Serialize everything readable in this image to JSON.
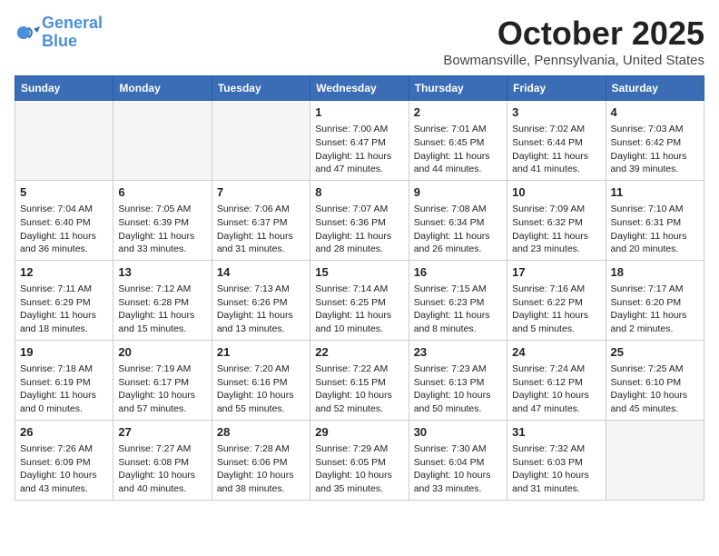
{
  "header": {
    "logo_line1": "General",
    "logo_line2": "Blue",
    "month": "October 2025",
    "location": "Bowmansville, Pennsylvania, United States"
  },
  "days_of_week": [
    "Sunday",
    "Monday",
    "Tuesday",
    "Wednesday",
    "Thursday",
    "Friday",
    "Saturday"
  ],
  "weeks": [
    {
      "days": [
        {
          "number": "",
          "empty": true
        },
        {
          "number": "",
          "empty": true
        },
        {
          "number": "",
          "empty": true
        },
        {
          "number": "1",
          "sunrise": "7:00 AM",
          "sunset": "6:47 PM",
          "daylight": "11 hours and 47 minutes."
        },
        {
          "number": "2",
          "sunrise": "7:01 AM",
          "sunset": "6:45 PM",
          "daylight": "11 hours and 44 minutes."
        },
        {
          "number": "3",
          "sunrise": "7:02 AM",
          "sunset": "6:44 PM",
          "daylight": "11 hours and 41 minutes."
        },
        {
          "number": "4",
          "sunrise": "7:03 AM",
          "sunset": "6:42 PM",
          "daylight": "11 hours and 39 minutes."
        }
      ]
    },
    {
      "days": [
        {
          "number": "5",
          "sunrise": "7:04 AM",
          "sunset": "6:40 PM",
          "daylight": "11 hours and 36 minutes."
        },
        {
          "number": "6",
          "sunrise": "7:05 AM",
          "sunset": "6:39 PM",
          "daylight": "11 hours and 33 minutes."
        },
        {
          "number": "7",
          "sunrise": "7:06 AM",
          "sunset": "6:37 PM",
          "daylight": "11 hours and 31 minutes."
        },
        {
          "number": "8",
          "sunrise": "7:07 AM",
          "sunset": "6:36 PM",
          "daylight": "11 hours and 28 minutes."
        },
        {
          "number": "9",
          "sunrise": "7:08 AM",
          "sunset": "6:34 PM",
          "daylight": "11 hours and 26 minutes."
        },
        {
          "number": "10",
          "sunrise": "7:09 AM",
          "sunset": "6:32 PM",
          "daylight": "11 hours and 23 minutes."
        },
        {
          "number": "11",
          "sunrise": "7:10 AM",
          "sunset": "6:31 PM",
          "daylight": "11 hours and 20 minutes."
        }
      ]
    },
    {
      "days": [
        {
          "number": "12",
          "sunrise": "7:11 AM",
          "sunset": "6:29 PM",
          "daylight": "11 hours and 18 minutes."
        },
        {
          "number": "13",
          "sunrise": "7:12 AM",
          "sunset": "6:28 PM",
          "daylight": "11 hours and 15 minutes."
        },
        {
          "number": "14",
          "sunrise": "7:13 AM",
          "sunset": "6:26 PM",
          "daylight": "11 hours and 13 minutes."
        },
        {
          "number": "15",
          "sunrise": "7:14 AM",
          "sunset": "6:25 PM",
          "daylight": "11 hours and 10 minutes."
        },
        {
          "number": "16",
          "sunrise": "7:15 AM",
          "sunset": "6:23 PM",
          "daylight": "11 hours and 8 minutes."
        },
        {
          "number": "17",
          "sunrise": "7:16 AM",
          "sunset": "6:22 PM",
          "daylight": "11 hours and 5 minutes."
        },
        {
          "number": "18",
          "sunrise": "7:17 AM",
          "sunset": "6:20 PM",
          "daylight": "11 hours and 2 minutes."
        }
      ]
    },
    {
      "days": [
        {
          "number": "19",
          "sunrise": "7:18 AM",
          "sunset": "6:19 PM",
          "daylight": "11 hours and 0 minutes."
        },
        {
          "number": "20",
          "sunrise": "7:19 AM",
          "sunset": "6:17 PM",
          "daylight": "10 hours and 57 minutes."
        },
        {
          "number": "21",
          "sunrise": "7:20 AM",
          "sunset": "6:16 PM",
          "daylight": "10 hours and 55 minutes."
        },
        {
          "number": "22",
          "sunrise": "7:22 AM",
          "sunset": "6:15 PM",
          "daylight": "10 hours and 52 minutes."
        },
        {
          "number": "23",
          "sunrise": "7:23 AM",
          "sunset": "6:13 PM",
          "daylight": "10 hours and 50 minutes."
        },
        {
          "number": "24",
          "sunrise": "7:24 AM",
          "sunset": "6:12 PM",
          "daylight": "10 hours and 47 minutes."
        },
        {
          "number": "25",
          "sunrise": "7:25 AM",
          "sunset": "6:10 PM",
          "daylight": "10 hours and 45 minutes."
        }
      ]
    },
    {
      "days": [
        {
          "number": "26",
          "sunrise": "7:26 AM",
          "sunset": "6:09 PM",
          "daylight": "10 hours and 43 minutes."
        },
        {
          "number": "27",
          "sunrise": "7:27 AM",
          "sunset": "6:08 PM",
          "daylight": "10 hours and 40 minutes."
        },
        {
          "number": "28",
          "sunrise": "7:28 AM",
          "sunset": "6:06 PM",
          "daylight": "10 hours and 38 minutes."
        },
        {
          "number": "29",
          "sunrise": "7:29 AM",
          "sunset": "6:05 PM",
          "daylight": "10 hours and 35 minutes."
        },
        {
          "number": "30",
          "sunrise": "7:30 AM",
          "sunset": "6:04 PM",
          "daylight": "10 hours and 33 minutes."
        },
        {
          "number": "31",
          "sunrise": "7:32 AM",
          "sunset": "6:03 PM",
          "daylight": "10 hours and 31 minutes."
        },
        {
          "number": "",
          "empty": true
        }
      ]
    }
  ],
  "labels": {
    "sunrise": "Sunrise:",
    "sunset": "Sunset:",
    "daylight": "Daylight:"
  }
}
